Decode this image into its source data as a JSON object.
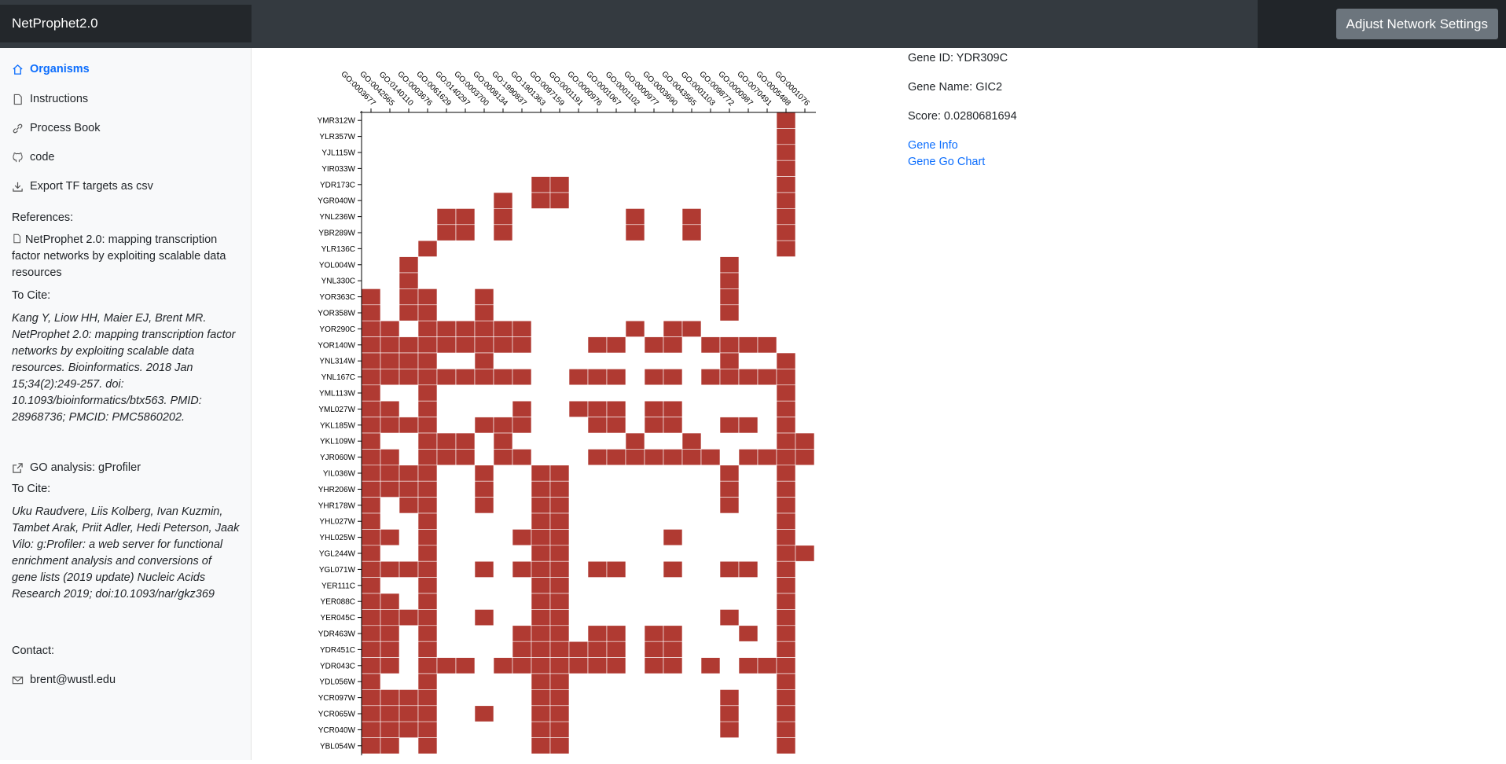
{
  "app": {
    "brand": "NetProphet2.0",
    "settings_button": "Adjust Network Settings"
  },
  "sidebar": {
    "nav": [
      {
        "label": "Organisms",
        "icon": "home-icon",
        "active": true
      },
      {
        "label": "Instructions",
        "icon": "document-icon"
      },
      {
        "label": "Process Book",
        "icon": "link-icon"
      },
      {
        "label": "code",
        "icon": "github-icon"
      },
      {
        "label": "Export TF targets as csv",
        "icon": "download-icon"
      }
    ],
    "references_label": "References:",
    "reference_title": "NetProphet 2.0: mapping transcription factor networks by exploiting scalable data resources",
    "cite_label_1": "To Cite:",
    "citation_1": "Kang Y, Liow HH, Maier EJ, Brent MR. NetProphet 2.0: mapping transcription factor networks by exploiting scalable data resources. Bioinformatics. 2018 Jan 15;34(2):249-257. doi: 10.1093/bioinformatics/btx563. PMID: 28968736; PMCID: PMC5860202.",
    "go_link": "GO analysis: gProfiler",
    "cite_label_2": "To Cite:",
    "citation_2": "Uku Raudvere, Liis Kolberg, Ivan Kuzmin, Tambet Arak, Priit Adler, Hedi Peterson, Jaak Vilo: g:Profiler: a web server for functional enrichment analysis and conversions of gene lists (2019 update) Nucleic Acids Research 2019; doi:10.1093/nar/gkz369",
    "contact_label": "Contact:",
    "contact_email": "brent@wustl.edu"
  },
  "gene_info": {
    "gene_id": "Gene ID: YDR309C",
    "gene_name": "Gene Name: GIC2",
    "score": "Score: 0.0280681694",
    "link_info": "Gene Info",
    "link_go": "Gene Go Chart"
  },
  "chart_data": {
    "type": "heatmap",
    "cell_color": "#b03a32",
    "x": [
      "GO:0003677",
      "GO:0042565",
      "GO:0140110",
      "GO:0003676",
      "GO:0061629",
      "GO:0140297",
      "GO:0003700",
      "GO:0008134",
      "GO:1990837",
      "GO:1901363",
      "GO:0097159",
      "GO:0001191",
      "GO:0000976",
      "GO:0001067",
      "GO:0001102",
      "GO:0000977",
      "GO:0003690",
      "GO:0043565",
      "GO:0001103",
      "GO:0098772",
      "GO:0000987",
      "GO:0070491",
      "GO:0005488",
      "GO:0001076"
    ],
    "y": [
      "YMR312W",
      "YLR357W",
      "YJL115W",
      "YIR033W",
      "YDR173C",
      "YGR040W",
      "YNL236W",
      "YBR289W",
      "YLR136C",
      "YOL004W",
      "YNL330C",
      "YOR363C",
      "YOR358W",
      "YOR290C",
      "YOR140W",
      "YNL314W",
      "YNL167C",
      "YML113W",
      "YML027W",
      "YKL185W",
      "YKL109W",
      "YJR060W",
      "YIL036W",
      "YHR206W",
      "YHR178W",
      "YHL027W",
      "YHL025W",
      "YGL244W",
      "YGL071W",
      "YER111C",
      "YER088C",
      "YER045C",
      "YDR463W",
      "YDR451C",
      "YDR043C",
      "YDL056W",
      "YCR097W",
      "YCR065W",
      "YCR040W",
      "YBL054W"
    ],
    "cells": [
      [
        0,
        0,
        0,
        0,
        0,
        0,
        0,
        0,
        0,
        0,
        0,
        0,
        0,
        0,
        0,
        0,
        0,
        0,
        0,
        0,
        0,
        0,
        1,
        0
      ],
      [
        0,
        0,
        0,
        0,
        0,
        0,
        0,
        0,
        0,
        0,
        0,
        0,
        0,
        0,
        0,
        0,
        0,
        0,
        0,
        0,
        0,
        0,
        1,
        0
      ],
      [
        0,
        0,
        0,
        0,
        0,
        0,
        0,
        0,
        0,
        0,
        0,
        0,
        0,
        0,
        0,
        0,
        0,
        0,
        0,
        0,
        0,
        0,
        1,
        0
      ],
      [
        0,
        0,
        0,
        0,
        0,
        0,
        0,
        0,
        0,
        0,
        0,
        0,
        0,
        0,
        0,
        0,
        0,
        0,
        0,
        0,
        0,
        0,
        1,
        0
      ],
      [
        0,
        0,
        0,
        0,
        0,
        0,
        0,
        0,
        0,
        1,
        1,
        0,
        0,
        0,
        0,
        0,
        0,
        0,
        0,
        0,
        0,
        0,
        1,
        0
      ],
      [
        0,
        0,
        0,
        0,
        0,
        0,
        0,
        1,
        0,
        1,
        1,
        0,
        0,
        0,
        0,
        0,
        0,
        0,
        0,
        0,
        0,
        0,
        1,
        0
      ],
      [
        0,
        0,
        0,
        0,
        1,
        1,
        0,
        1,
        0,
        0,
        0,
        0,
        0,
        0,
        1,
        0,
        0,
        1,
        0,
        0,
        0,
        0,
        1,
        0
      ],
      [
        0,
        0,
        0,
        0,
        1,
        1,
        0,
        1,
        0,
        0,
        0,
        0,
        0,
        0,
        1,
        0,
        0,
        1,
        0,
        0,
        0,
        0,
        1,
        0
      ],
      [
        0,
        0,
        0,
        1,
        0,
        0,
        0,
        0,
        0,
        0,
        0,
        0,
        0,
        0,
        0,
        0,
        0,
        0,
        0,
        0,
        0,
        0,
        1,
        0
      ],
      [
        0,
        0,
        1,
        0,
        0,
        0,
        0,
        0,
        0,
        0,
        0,
        0,
        0,
        0,
        0,
        0,
        0,
        0,
        0,
        1,
        0,
        0,
        0,
        0
      ],
      [
        0,
        0,
        1,
        0,
        0,
        0,
        0,
        0,
        0,
        0,
        0,
        0,
        0,
        0,
        0,
        0,
        0,
        0,
        0,
        1,
        0,
        0,
        0,
        0
      ],
      [
        1,
        0,
        1,
        1,
        0,
        0,
        1,
        0,
        0,
        0,
        0,
        0,
        0,
        0,
        0,
        0,
        0,
        0,
        0,
        1,
        0,
        0,
        0,
        0
      ],
      [
        1,
        0,
        1,
        1,
        0,
        0,
        1,
        0,
        0,
        0,
        0,
        0,
        0,
        0,
        0,
        0,
        0,
        0,
        0,
        1,
        0,
        0,
        0,
        0
      ],
      [
        1,
        1,
        0,
        1,
        1,
        1,
        1,
        1,
        1,
        0,
        0,
        0,
        0,
        0,
        1,
        0,
        1,
        1,
        0,
        0,
        0,
        0,
        0,
        0
      ],
      [
        1,
        1,
        1,
        1,
        1,
        1,
        1,
        1,
        1,
        0,
        0,
        0,
        1,
        1,
        0,
        1,
        1,
        0,
        1,
        1,
        1,
        1,
        0,
        0
      ],
      [
        1,
        1,
        1,
        1,
        0,
        0,
        1,
        0,
        0,
        0,
        0,
        0,
        0,
        0,
        0,
        0,
        0,
        0,
        0,
        1,
        0,
        0,
        1,
        0
      ],
      [
        1,
        1,
        1,
        1,
        1,
        1,
        1,
        1,
        1,
        0,
        0,
        1,
        1,
        1,
        0,
        1,
        1,
        0,
        1,
        1,
        1,
        1,
        1,
        0
      ],
      [
        1,
        0,
        0,
        1,
        0,
        0,
        0,
        0,
        0,
        0,
        0,
        0,
        0,
        0,
        0,
        0,
        0,
        0,
        0,
        0,
        0,
        0,
        1,
        0
      ],
      [
        1,
        1,
        0,
        1,
        0,
        0,
        0,
        0,
        1,
        0,
        0,
        1,
        1,
        1,
        0,
        1,
        1,
        0,
        0,
        0,
        0,
        0,
        1,
        0
      ],
      [
        1,
        1,
        1,
        1,
        0,
        0,
        1,
        1,
        1,
        0,
        0,
        0,
        1,
        1,
        0,
        1,
        1,
        0,
        0,
        1,
        1,
        0,
        1,
        0
      ],
      [
        1,
        0,
        0,
        1,
        1,
        1,
        0,
        1,
        0,
        0,
        0,
        0,
        0,
        0,
        1,
        0,
        0,
        1,
        0,
        0,
        0,
        0,
        1,
        1
      ],
      [
        1,
        1,
        0,
        1,
        1,
        1,
        0,
        1,
        1,
        0,
        0,
        0,
        1,
        1,
        1,
        1,
        1,
        1,
        1,
        0,
        1,
        1,
        1,
        1
      ],
      [
        1,
        1,
        1,
        1,
        0,
        0,
        1,
        0,
        0,
        1,
        1,
        0,
        0,
        0,
        0,
        0,
        0,
        0,
        0,
        1,
        0,
        0,
        1,
        0
      ],
      [
        1,
        1,
        1,
        1,
        0,
        0,
        1,
        0,
        0,
        1,
        1,
        0,
        0,
        0,
        0,
        0,
        0,
        0,
        0,
        1,
        0,
        0,
        1,
        0
      ],
      [
        1,
        0,
        1,
        1,
        0,
        0,
        1,
        0,
        0,
        1,
        1,
        0,
        0,
        0,
        0,
        0,
        0,
        0,
        0,
        1,
        0,
        0,
        1,
        0
      ],
      [
        1,
        0,
        0,
        1,
        0,
        0,
        0,
        0,
        0,
        1,
        1,
        0,
        0,
        0,
        0,
        0,
        0,
        0,
        0,
        0,
        0,
        0,
        1,
        0
      ],
      [
        1,
        1,
        0,
        1,
        0,
        0,
        0,
        0,
        1,
        1,
        1,
        0,
        0,
        0,
        0,
        0,
        1,
        0,
        0,
        0,
        0,
        0,
        1,
        0
      ],
      [
        1,
        0,
        0,
        1,
        0,
        0,
        0,
        0,
        0,
        1,
        1,
        0,
        0,
        0,
        0,
        0,
        0,
        0,
        0,
        0,
        0,
        0,
        1,
        1
      ],
      [
        1,
        1,
        1,
        1,
        0,
        0,
        1,
        0,
        1,
        1,
        1,
        0,
        1,
        1,
        0,
        0,
        1,
        0,
        0,
        1,
        1,
        0,
        1,
        0
      ],
      [
        1,
        0,
        0,
        1,
        0,
        0,
        0,
        0,
        0,
        1,
        1,
        0,
        0,
        0,
        0,
        0,
        0,
        0,
        0,
        0,
        0,
        0,
        1,
        0
      ],
      [
        1,
        1,
        0,
        1,
        0,
        0,
        0,
        0,
        0,
        1,
        1,
        0,
        0,
        0,
        0,
        0,
        0,
        0,
        0,
        0,
        0,
        0,
        1,
        0
      ],
      [
        1,
        1,
        1,
        1,
        0,
        0,
        1,
        0,
        0,
        1,
        1,
        0,
        0,
        0,
        0,
        0,
        0,
        0,
        0,
        1,
        0,
        0,
        1,
        0
      ],
      [
        1,
        1,
        0,
        1,
        0,
        0,
        0,
        0,
        1,
        1,
        1,
        0,
        1,
        1,
        0,
        1,
        1,
        0,
        0,
        0,
        1,
        0,
        1,
        0
      ],
      [
        1,
        1,
        0,
        1,
        0,
        0,
        0,
        0,
        1,
        1,
        1,
        1,
        1,
        1,
        0,
        1,
        1,
        0,
        0,
        0,
        0,
        0,
        1,
        0
      ],
      [
        1,
        1,
        0,
        1,
        1,
        1,
        0,
        1,
        1,
        1,
        1,
        1,
        1,
        1,
        0,
        1,
        1,
        0,
        1,
        0,
        1,
        1,
        1,
        0
      ],
      [
        1,
        0,
        0,
        1,
        0,
        0,
        0,
        0,
        0,
        1,
        1,
        0,
        0,
        0,
        0,
        0,
        0,
        0,
        0,
        0,
        0,
        0,
        1,
        0
      ],
      [
        1,
        1,
        1,
        1,
        0,
        0,
        0,
        0,
        0,
        1,
        1,
        0,
        0,
        0,
        0,
        0,
        0,
        0,
        0,
        1,
        0,
        0,
        1,
        0
      ],
      [
        1,
        1,
        1,
        1,
        0,
        0,
        1,
        0,
        0,
        1,
        1,
        0,
        0,
        0,
        0,
        0,
        0,
        0,
        0,
        1,
        0,
        0,
        1,
        0
      ],
      [
        1,
        1,
        1,
        1,
        0,
        0,
        0,
        0,
        0,
        1,
        1,
        0,
        0,
        0,
        0,
        0,
        0,
        0,
        0,
        1,
        0,
        0,
        1,
        0
      ],
      [
        1,
        1,
        0,
        1,
        0,
        0,
        0,
        0,
        0,
        1,
        1,
        0,
        0,
        0,
        0,
        0,
        0,
        0,
        0,
        0,
        0,
        0,
        1,
        0
      ]
    ]
  }
}
